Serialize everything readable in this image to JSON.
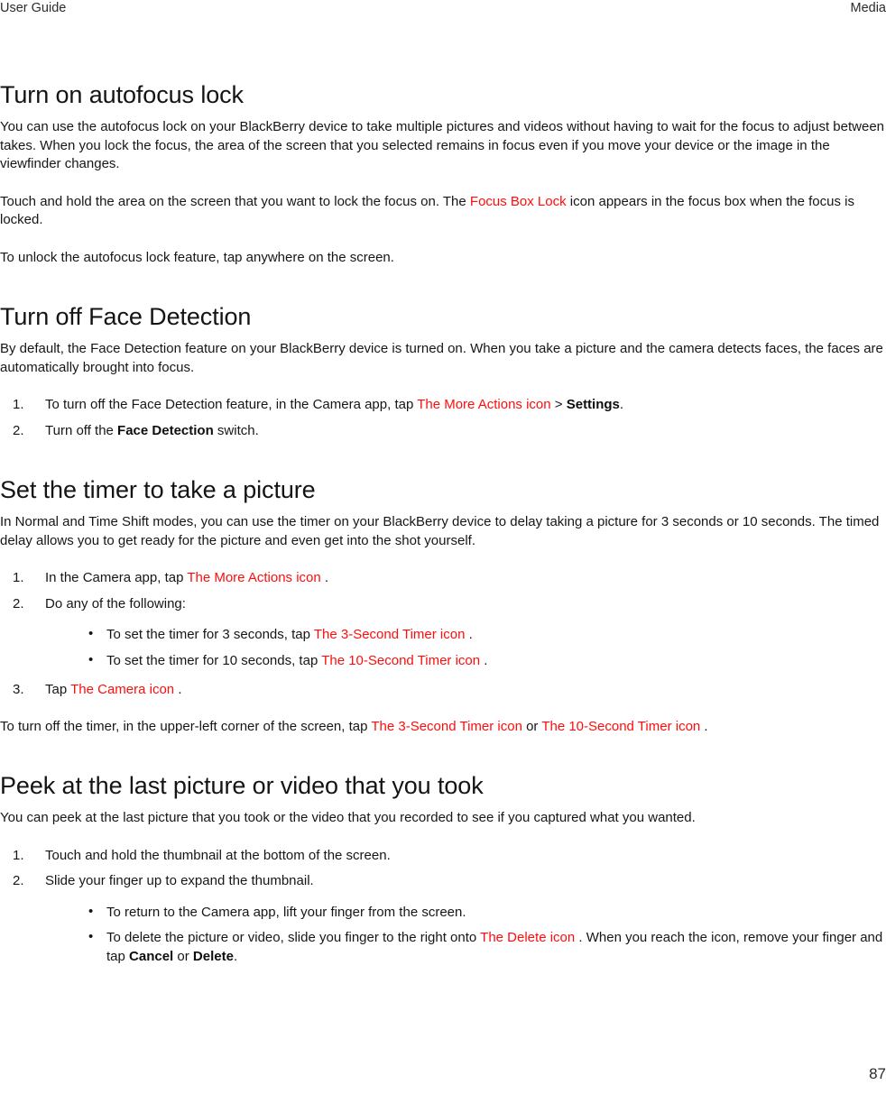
{
  "header": {
    "left": "User Guide",
    "right": "Media"
  },
  "colors": {
    "icon_reference_red": "#ff0d0d",
    "body_text": "#161616",
    "page_background": "#ffffff"
  },
  "sections": [
    {
      "id": "autofocus-lock",
      "title": "Turn on autofocus lock",
      "paragraph_1": "You can use the autofocus lock on your BlackBerry device to take multiple pictures and videos without having to wait for the focus to adjust between takes. When you lock the focus, the area of the screen that you selected remains in focus even if you move your device or the image in the viewfinder changes.",
      "paragraph_2_before": "Touch and hold the area on the screen that you want to lock the focus on. The ",
      "paragraph_2_icon": "Focus Box Lock",
      "paragraph_2_after": " icon appears in the focus box when the focus is locked.",
      "paragraph_3": "To unlock the autofocus lock feature, tap anywhere on the screen."
    },
    {
      "id": "face-detection",
      "title": "Turn off Face Detection",
      "paragraph_1": "By default, the Face Detection feature on your BlackBerry device is turned on. When you take a picture and the camera detects faces, the faces are automatically brought into focus.",
      "step_1_before": "To turn off the Face Detection feature, in the Camera app, tap ",
      "step_1_icon": "The More Actions icon",
      "step_1_separator": " > ",
      "step_1_bold": "Settings",
      "step_1_after": ".",
      "step_2_before": "Turn off the ",
      "step_2_bold": "Face Detection",
      "step_2_after": " switch."
    },
    {
      "id": "set-timer",
      "title": "Set the timer to take a picture",
      "paragraph_1": "In Normal and Time Shift modes, you can use the timer on your BlackBerry device to delay taking a picture for 3 seconds or 10 seconds. The timed delay allows you to get ready for the picture and even get into the shot yourself.",
      "step_1_before": "In the Camera app, tap ",
      "step_1_icon": "The More Actions icon",
      "step_1_after": " .",
      "step_2": "Do any of the following:",
      "bullet_1_before": "To set the timer for 3 seconds, tap ",
      "bullet_1_icon": "The 3-Second Timer icon",
      "bullet_1_after": " .",
      "bullet_2_before": "To set the timer for 10 seconds, tap ",
      "bullet_2_icon": "The 10-Second Timer icon",
      "bullet_2_after": " .",
      "step_3_before": "Tap ",
      "step_3_icon": "The Camera icon",
      "step_3_after": " .",
      "closing_before": "To turn off the timer, in the upper-left corner of the screen, tap ",
      "closing_icon_1": "The 3-Second Timer icon",
      "closing_middle": " or ",
      "closing_icon_2": "The 10-Second Timer icon",
      "closing_after": " ."
    },
    {
      "id": "peek-last-picture",
      "title": "Peek at the last picture or video that you took",
      "paragraph_1": "You can peek at the last picture that you took or the video that you recorded to see if you captured what you wanted.",
      "step_1": "Touch and hold the thumbnail at the bottom of the screen.",
      "step_2": "Slide your finger up to expand the thumbnail.",
      "bullet_1": " To return to the Camera app, lift your finger from the screen.",
      "bullet_2_before": "To delete the picture or video, slide you finger to the right onto ",
      "bullet_2_icon": "The Delete icon",
      "bullet_2_mid": " . When you reach the icon, remove your finger and tap ",
      "bullet_2_bold_1": "Cancel",
      "bullet_2_or": " or ",
      "bullet_2_bold_2": "Delete",
      "bullet_2_after": "."
    }
  ],
  "footer": {
    "page_number": "87"
  }
}
